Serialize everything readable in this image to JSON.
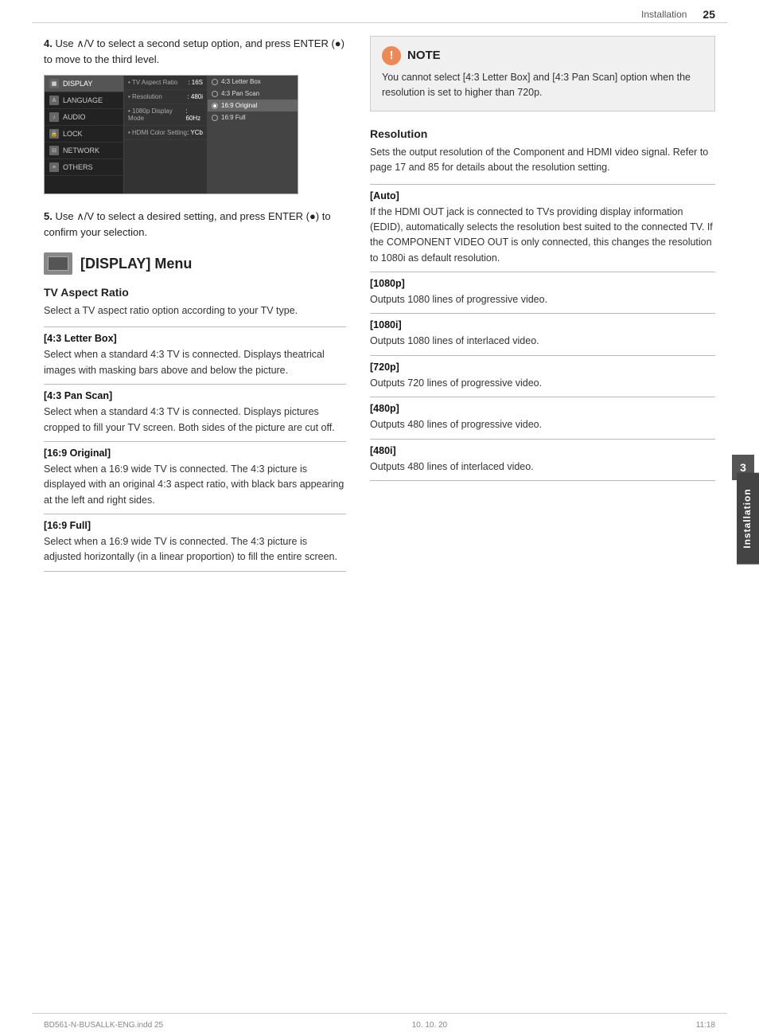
{
  "header": {
    "section": "Installation",
    "page_number": "25"
  },
  "footer": {
    "file_info": "BD561-N-BUSALLK-ENG.indd   25",
    "date": "10. 10. 20",
    "time": "11:18"
  },
  "side_tab": {
    "label": "Installation",
    "number": "3"
  },
  "steps": [
    {
      "number": "4.",
      "text": "Use ∧/V to select a second setup option, and press ENTER (●) to move to the third level."
    },
    {
      "number": "5.",
      "text": "Use ∧/V to select a desired setting, and press ENTER (●) to confirm your selection."
    }
  ],
  "display_menu": {
    "title": "[DISPLAY] Menu"
  },
  "tv_aspect_ratio": {
    "heading": "TV Aspect Ratio",
    "desc": "Select a TV aspect ratio option according to your TV type.",
    "items": [
      {
        "title": "[4:3 Letter Box]",
        "desc": "Select when a standard 4:3 TV is connected. Displays theatrical images with masking bars above and below the picture."
      },
      {
        "title": "[4:3 Pan Scan]",
        "desc": "Select when a standard 4:3 TV is connected. Displays pictures cropped to fill your TV screen. Both sides of the picture are cut off."
      },
      {
        "title": "[16:9 Original]",
        "desc": "Select when a 16:9 wide TV is connected. The 4:3 picture is displayed with an original 4:3 aspect ratio, with black bars appearing at the left and right sides."
      },
      {
        "title": "[16:9 Full]",
        "desc": "Select when a 16:9 wide TV is connected. The 4:3 picture is adjusted horizontally (in a linear proportion) to fill the entire screen."
      }
    ]
  },
  "note": {
    "icon": "!",
    "title": "NOTE",
    "text": "You cannot select [4:3 Letter Box] and [4:3 Pan Scan] option when the resolution is set to higher than 720p."
  },
  "resolution": {
    "heading": "Resolution",
    "desc": "Sets the output resolution of the Component and HDMI video signal. Refer to page 17 and 85 for details about the resolution setting.",
    "items": [
      {
        "title": "[Auto]",
        "desc": "If the HDMI OUT jack is connected to TVs providing display information (EDID), automatically selects the resolution best suited to the connected TV. If the COMPONENT VIDEO OUT is only connected, this changes the resolution to 1080i as default resolution."
      },
      {
        "title": "[1080p]",
        "desc": "Outputs 1080 lines of progressive video."
      },
      {
        "title": "[1080i]",
        "desc": "Outputs 1080 lines of interlaced video."
      },
      {
        "title": "[720p]",
        "desc": "Outputs 720 lines of progressive video."
      },
      {
        "title": "[480p]",
        "desc": "Outputs 480 lines of progressive video."
      },
      {
        "title": "[480i]",
        "desc": "Outputs 480 lines of interlaced video."
      }
    ]
  },
  "menu_screenshot": {
    "left_items": [
      "DISPLAY",
      "LANGUAGE",
      "AUDIO",
      "LOCK",
      "NETWORK",
      "OTHERS"
    ],
    "active_left": "DISPLAY",
    "mid_items": [
      {
        "label": "• TV Aspect Ratio",
        "value": ": 16S"
      },
      {
        "label": "• Resolution",
        "value": ": 480i"
      },
      {
        "label": "• 1080p Display Mode",
        "value": ": 60Hz"
      },
      {
        "label": "• HDMI Color Setting",
        "value": ": YCb"
      }
    ],
    "right_items": [
      {
        "label": "4:3 Letter Box",
        "selected": false
      },
      {
        "label": "4:3 Pan Scan",
        "selected": false
      },
      {
        "label": "16:9 Original",
        "selected": true
      },
      {
        "label": "16:9 Full",
        "selected": false
      }
    ]
  }
}
